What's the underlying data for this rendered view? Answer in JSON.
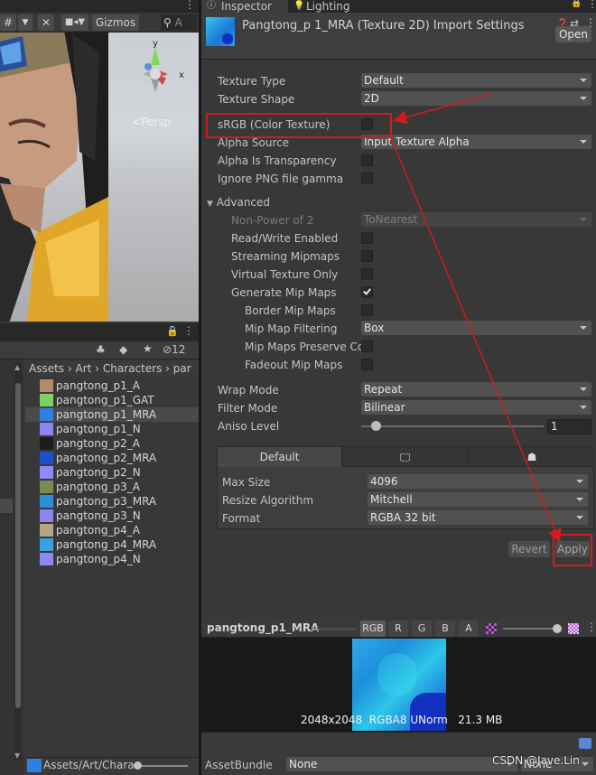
{
  "scene_view": {
    "gizmos_label": "Gizmos",
    "search_placeholder": "A",
    "persp_label": "Persp",
    "axis_y": "y",
    "axis_x": "x"
  },
  "project": {
    "hidden_count": "12",
    "breadcrumb": [
      "Assets",
      "Art",
      "Characters",
      "par"
    ],
    "files": [
      {
        "name": "pangtong_p1_A",
        "color": "#b58a6a",
        "selected": false
      },
      {
        "name": "pangtong_p1_GAT",
        "color": "#7fd06a",
        "selected": false
      },
      {
        "name": "pangtong_p1_MRA",
        "color": "#2f7fe0",
        "selected": true
      },
      {
        "name": "pangtong_p1_N",
        "color": "#8a86f0",
        "selected": false
      },
      {
        "name": "pangtong_p2_A",
        "color": "#1c1c1c",
        "selected": false
      },
      {
        "name": "pangtong_p2_MRA",
        "color": "#1e50c8",
        "selected": false
      },
      {
        "name": "pangtong_p2_N",
        "color": "#8e8cf2",
        "selected": false
      },
      {
        "name": "pangtong_p3_A",
        "color": "#7a8a55",
        "selected": false
      },
      {
        "name": "pangtong_p3_MRA",
        "color": "#2a8fd8",
        "selected": false
      },
      {
        "name": "pangtong_p3_N",
        "color": "#8a88f0",
        "selected": false
      },
      {
        "name": "pangtong_p4_A",
        "color": "#b4a488",
        "selected": false
      },
      {
        "name": "pangtong_p4_MRA",
        "color": "#3aa0e0",
        "selected": false
      },
      {
        "name": "pangtong_p4_N",
        "color": "#8c8af0",
        "selected": false
      }
    ],
    "bottom_path": "Assets/Art/Charac"
  },
  "inspector": {
    "tabs": {
      "inspector": "Inspector",
      "lighting": "Lighting"
    },
    "title": "Pangtong_p 1_MRA (Texture 2D) Import Settings",
    "open_button": "Open",
    "fields": {
      "texture_type": {
        "label": "Texture Type",
        "value": "Default"
      },
      "texture_shape": {
        "label": "Texture Shape",
        "value": "2D"
      },
      "srgb": {
        "label": "sRGB (Color Texture)",
        "checked": false
      },
      "alpha_source": {
        "label": "Alpha Source",
        "value": "Input Texture Alpha"
      },
      "alpha_transparency": {
        "label": "Alpha Is Transparency",
        "checked": false
      },
      "ignore_png_gamma": {
        "label": "Ignore PNG file gamma",
        "checked": false
      },
      "advanced": {
        "label": "Advanced"
      },
      "non_power_of_2": {
        "label": "Non-Power of 2",
        "value": "ToNearest"
      },
      "read_write": {
        "label": "Read/Write Enabled",
        "checked": false
      },
      "streaming_mipmaps": {
        "label": "Streaming Mipmaps",
        "checked": false
      },
      "virtual_texture": {
        "label": "Virtual Texture Only",
        "checked": false
      },
      "generate_mipmaps": {
        "label": "Generate Mip Maps",
        "checked": true
      },
      "border_mipmaps": {
        "label": "Border Mip Maps",
        "checked": false
      },
      "mipmap_filtering": {
        "label": "Mip Map Filtering",
        "value": "Box"
      },
      "mipmaps_preserve": {
        "label": "Mip Maps Preserve Co",
        "checked": false
      },
      "fadeout_mipmaps": {
        "label": "Fadeout Mip Maps",
        "checked": false
      },
      "wrap_mode": {
        "label": "Wrap Mode",
        "value": "Repeat"
      },
      "filter_mode": {
        "label": "Filter Mode",
        "value": "Bilinear"
      },
      "aniso_level": {
        "label": "Aniso Level",
        "value": "1"
      }
    },
    "platform": {
      "tab_default": "Default",
      "max_size": {
        "label": "Max Size",
        "value": "4096"
      },
      "resize_algorithm": {
        "label": "Resize Algorithm",
        "value": "Mitchell"
      },
      "format": {
        "label": "Format",
        "value": "RGBA 32 bit"
      }
    },
    "revert_button": "Revert",
    "apply_button": "Apply",
    "preview": {
      "name": "pangtong_p1_MRA",
      "channels": [
        "RGB",
        "R",
        "G",
        "B",
        "A"
      ],
      "info": "2048x2048  RGBA8 UNorm   21.3 MB"
    },
    "assetbundle": {
      "label": "AssetBundle",
      "value": "None",
      "variant": "None"
    }
  },
  "watermark": "CSDN @Jave.Lin",
  "annotation_color": "#d01c1c"
}
